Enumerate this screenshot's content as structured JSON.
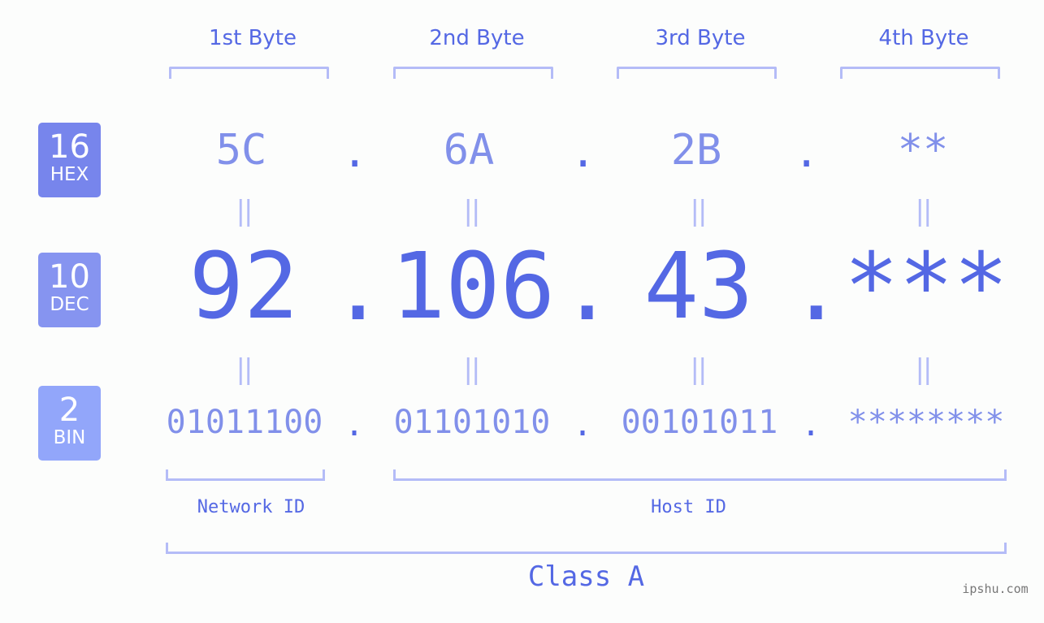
{
  "byte_headers": [
    "1st Byte",
    "2nd Byte",
    "3rd Byte",
    "4th Byte"
  ],
  "badges": {
    "hex": {
      "number": "16",
      "label": "HEX",
      "color": "#7785ec"
    },
    "dec": {
      "number": "10",
      "label": "DEC",
      "color": "#8694f0"
    },
    "bin": {
      "number": "2",
      "label": "BIN",
      "color": "#92a6fa"
    }
  },
  "hex": [
    "5C",
    "6A",
    "2B",
    "**"
  ],
  "dec": [
    "92",
    "106",
    "43",
    "***"
  ],
  "bin": [
    "01011100",
    "01101010",
    "00101011",
    "********"
  ],
  "separator": ".",
  "equals": "||",
  "parts": {
    "network_label": "Network ID",
    "host_label": "Host ID"
  },
  "class_label": "Class A",
  "watermark": "ipshu.com",
  "colors": {
    "primary": "#5468e4",
    "secondary": "#8190ea",
    "bracket": "#b4bcf7",
    "background": "#fcfdfc"
  }
}
